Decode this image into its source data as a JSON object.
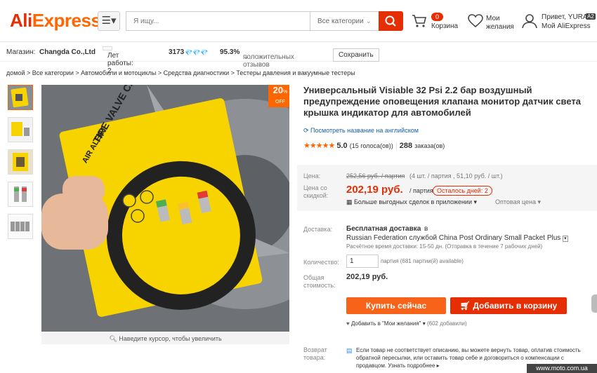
{
  "header": {
    "logo_ali": "Ali",
    "logo_express": "Express",
    "logo_tm": "®",
    "search_placeholder": "Я ищу...",
    "category_select": "Все категории",
    "cart_count": "0",
    "cart_label": "Корзина",
    "wishlist_label": "Мои желания",
    "user_greeting": "Привет, YURA",
    "user_badge": "A2",
    "user_account": "Мой AliExpress"
  },
  "store": {
    "label": "Магазин:",
    "name": "Changda Co.,Ltd",
    "years": "Лет работы: 2",
    "score": "3173",
    "feedback_pct": "95.3%",
    "feedback_label": "положительных отзывов",
    "save_label": "Сохранить"
  },
  "breadcrumb": "домой > Все категории > Автомобили и мотоциклы > Средства диагностики > Тестеры давления и вакуумные тестеры",
  "gallery": {
    "discount_pct": "20",
    "discount_unit": "%",
    "discount_off": "OFF",
    "card_text": "TIRE VALVE CAP",
    "card_sub": "AIR ALERT",
    "zoom_hint": "Наведите курсор, чтобы увеличить"
  },
  "product": {
    "title": "Универсальный Visiable 32 Psi 2.2 бар воздушный предупреждение оповещения клапана монитор датчик света крышка индикатор для автомобилей",
    "translate_link": "Посмотреть название на английском",
    "stars": "★★★★★",
    "rating": "5.0",
    "votes": "(15 голоса(ов))",
    "orders_count": "288",
    "orders_label": "заказа(ов)"
  },
  "price": {
    "price_label": "Цена:",
    "old_price": "252,56 руб. / партия",
    "old_price_note": "(4 шт. / партия , 51,10 руб. / шт.)",
    "discount_label": "Цена со скидкой:",
    "new_price": "202,19 руб.",
    "per_lot": "/ партия",
    "days_left": "Осталось дней: 2",
    "app_deals": "Больше выгодных сделок в приложении",
    "wholesale": "Оптовая цена"
  },
  "shipping": {
    "label": "Доставка:",
    "free": "Бесплатная доставка",
    "to": "в",
    "route": "Russian Federation службой China Post Ordinary Small Packet Plus",
    "eta": "Расчётное время доставки: 15-50 дн. (Отправка в течение 7 рабочих дней)"
  },
  "quantity": {
    "label": "Количество:",
    "value": "1",
    "available": "партия (681 партии(й) available)"
  },
  "total": {
    "label": "Общая стоимость:",
    "value": "202,19 руб."
  },
  "actions": {
    "buy_now": "Купить сейчас",
    "add_to_cart": "Добавить в корзину",
    "wishlist": "Добавить в \"Мои желания\"",
    "wishlist_count": "(602 добавили)"
  },
  "returns": {
    "label": "Возврат товара:",
    "text": "Если товар не соответствует описанию, вы можете вернуть товар, оплатив стоимость обратной пересылки, или оставить товар себе и договориться о компенсации с продавцом.",
    "more": "Узнать подробнее"
  },
  "watermark": "www.moto.com.ua",
  "colors": {
    "brand": "#e62e04",
    "buy": "#f66319",
    "link": "#1a5ea8",
    "card_yellow": "#f7d400"
  }
}
